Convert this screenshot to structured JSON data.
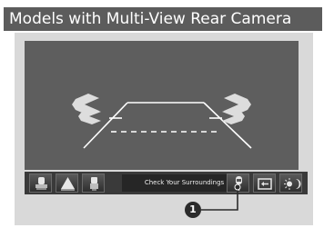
{
  "header": {
    "title": "Models with Multi-View Rear Camera"
  },
  "toolbar": {
    "buttons": [
      {
        "icon": "top-down-view-icon"
      },
      {
        "icon": "normal-view-icon"
      },
      {
        "icon": "wide-view-icon"
      }
    ],
    "status_text": "Check Your Surroundings",
    "right_buttons": [
      {
        "icon": "parking-sensor-icon"
      },
      {
        "icon": "guideline-toggle-icon"
      },
      {
        "icon": "brightness-icon"
      }
    ]
  },
  "callout": {
    "number": "1"
  },
  "colors": {
    "title_bar": "#5c5c5c",
    "camera_view": "#5e5e5e",
    "guide_lines": "#ffffff",
    "toolbar": "#3a3a3a"
  }
}
